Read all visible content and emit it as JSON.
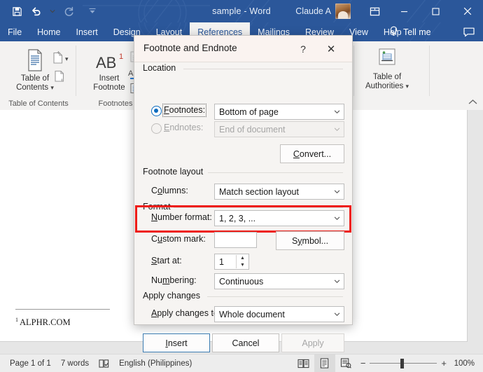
{
  "titlebar": {
    "document_title": "sample  -  Word",
    "account_name": "Claude A",
    "qat": [
      {
        "name": "save",
        "label": "Save"
      },
      {
        "name": "undo",
        "label": "Undo"
      },
      {
        "name": "undo-dropdown",
        "label": "Undo options"
      },
      {
        "name": "redo",
        "label": "Redo"
      },
      {
        "name": "customize-qat",
        "label": "Customize Quick Access Toolbar"
      }
    ],
    "window_controls": {
      "ribbon_display": "Ribbon Display Options",
      "minimize": "–",
      "restore": "☐",
      "close": "✕"
    }
  },
  "tabs": [
    {
      "label": "File",
      "active": false
    },
    {
      "label": "Home",
      "active": false
    },
    {
      "label": "Insert",
      "active": false
    },
    {
      "label": "Design",
      "active": false
    },
    {
      "label": "Layout",
      "active": false
    },
    {
      "label": "References",
      "active": true
    },
    {
      "label": "Mailings",
      "active": false
    },
    {
      "label": "Review",
      "active": false
    },
    {
      "label": "View",
      "active": false
    },
    {
      "label": "Help",
      "active": false
    }
  ],
  "tellme": {
    "label": "Tell me",
    "icon": "lightbulb-icon"
  },
  "comments": {
    "icon": "comment-icon"
  },
  "ribbon": {
    "groups": [
      {
        "name": "table-of-contents",
        "label": "Table of Contents",
        "big_button": {
          "line1": "Table of",
          "line2": "Contents",
          "has_chevron": true
        },
        "small_buttons": [
          {
            "name": "add-text",
            "label": "Add Text",
            "has_chevron": true
          },
          {
            "name": "update-table",
            "label": "Update Table"
          }
        ]
      },
      {
        "name": "footnotes",
        "label": "Footnotes",
        "big_button": {
          "line1": "Insert",
          "line2": "Footnote",
          "glyph": "AB",
          "sup": "1"
        },
        "small_buttons": [
          {
            "name": "insert-endnote",
            "label": "Insert Endnote"
          },
          {
            "name": "next-footnote",
            "label": "Next Footnote",
            "glyph": "AB",
            "sup": "1"
          },
          {
            "name": "show-notes",
            "label": "Show Notes"
          }
        ]
      },
      {
        "name": "table-of-authorities",
        "label": "",
        "big_button": {
          "line1": "Table of",
          "line2": "Authorities",
          "has_chevron": true
        }
      }
    ],
    "collapse_label": "Collapse the Ribbon"
  },
  "document": {
    "footnote_marker": "1",
    "footnote_text": "ALPHR.COM"
  },
  "dialog": {
    "title": "Footnote and Endnote",
    "help_glyph": "?",
    "close_glyph": "✕",
    "sections": {
      "location": {
        "label": "Location",
        "footnotes": {
          "radio_label": "Footnotes:",
          "selected": true,
          "value": "Bottom of page"
        },
        "endnotes": {
          "radio_label": "Endnotes:",
          "selected": false,
          "value": "End of document",
          "disabled": true
        },
        "convert_button": "Convert..."
      },
      "footnote_layout": {
        "label": "Footnote layout",
        "columns": {
          "label": "Columns:",
          "value": "Match section layout"
        }
      },
      "format": {
        "label": "Format",
        "number_format": {
          "label": "Number format:",
          "value": "1, 2, 3, ...",
          "highlighted": true
        },
        "custom_mark": {
          "label": "Custom mark:",
          "value": ""
        },
        "symbol_button": "Symbol...",
        "start_at": {
          "label": "Start at:",
          "value": "1"
        },
        "numbering": {
          "label": "Numbering:",
          "value": "Continuous"
        }
      },
      "apply_changes": {
        "label": "Apply changes",
        "apply_to": {
          "label": "Apply changes to:",
          "value": "Whole document"
        }
      }
    },
    "buttons": {
      "insert": "Insert",
      "cancel": "Cancel",
      "apply": "Apply"
    },
    "highlight_color": "#ee1c18"
  },
  "statusbar": {
    "page": "Page 1 of 1",
    "words": "7 words",
    "proofing_icon": "proofing-icon",
    "language": "English (Philippines)",
    "views": [
      {
        "name": "read-mode",
        "label": "Read Mode",
        "selected": false
      },
      {
        "name": "print-layout",
        "label": "Print Layout",
        "selected": true
      },
      {
        "name": "web-layout",
        "label": "Web Layout",
        "selected": false
      }
    ],
    "zoom_out": "−",
    "zoom_in": "+",
    "zoom_level": "100%"
  }
}
